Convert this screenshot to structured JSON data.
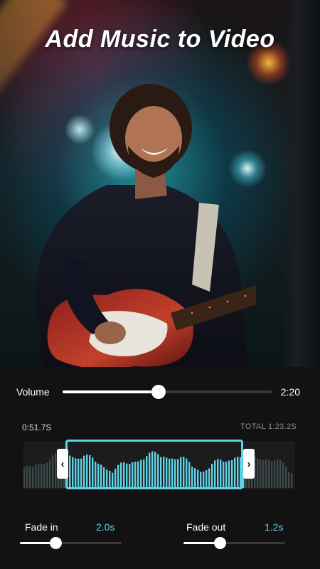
{
  "header": {
    "title": "Add Music to Video"
  },
  "volume": {
    "label": "Volume",
    "duration": "2:20",
    "level": 0.46
  },
  "timeline": {
    "current_time": "0:51.7S",
    "total": "TOTAL 1:23.2S",
    "selection_start": 0.155,
    "selection_end": 0.81
  },
  "fade_in": {
    "label": "Fade in",
    "value": "2.0s",
    "level": 0.35
  },
  "fade_out": {
    "label": "Fade out",
    "value": "1.2s",
    "level": 0.36
  },
  "colors": {
    "accent": "#5fd3e6",
    "background": "#121212",
    "track": "#3a3a3a"
  },
  "icons": {
    "left_handle": "chevron-left-icon",
    "right_handle": "chevron-right-icon"
  }
}
